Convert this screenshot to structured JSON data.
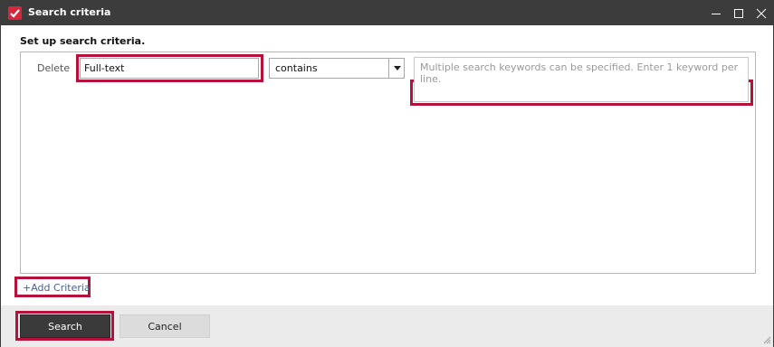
{
  "window": {
    "title": "Search criteria"
  },
  "form": {
    "heading": "Set up search criteria.",
    "criteria": [
      {
        "delete_label": "Delete",
        "field_value": "Full-text",
        "operator_value": "contains",
        "keywords_placeholder": "Multiple search keywords can be specified. Enter 1 keyword per line."
      }
    ],
    "add_criteria_label": "+Add Criteria"
  },
  "footer": {
    "search_label": "Search",
    "cancel_label": "Cancel"
  },
  "colors": {
    "titlebar": "#3c3c3c",
    "highlight": "#b5113a",
    "app_icon": "#d9263b",
    "link": "#4a5f8f"
  },
  "icons": {
    "app": "app-logo-icon",
    "minimize": "minimize-icon",
    "maximize": "maximize-icon",
    "close": "close-icon",
    "dropdown": "caret-down-icon",
    "resize": "resize-grip-icon"
  }
}
